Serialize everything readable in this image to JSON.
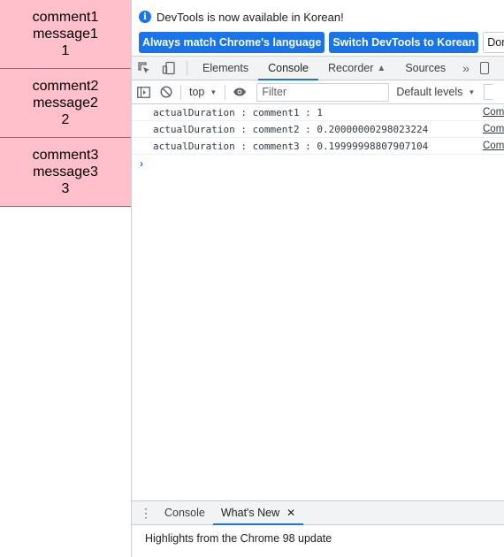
{
  "page": {
    "comments": [
      {
        "name": "comment1",
        "message": "message1",
        "count": "1"
      },
      {
        "name": "comment2",
        "message": "message2",
        "count": "2"
      },
      {
        "name": "comment3",
        "message": "message3",
        "count": "3"
      }
    ]
  },
  "infobar": {
    "text": "DevTools is now available in Korean!",
    "always_match_label": "Always match Chrome's language",
    "switch_label": "Switch DevTools to Korean",
    "dont_show_label": "Don't sh"
  },
  "tabs": {
    "items": [
      "Elements",
      "Console",
      "Recorder",
      "Sources"
    ],
    "active": "Console",
    "more": "»"
  },
  "console_toolbar": {
    "context": "top",
    "filter_placeholder": "Filter",
    "levels": "Default levels"
  },
  "console": {
    "messages": [
      {
        "text": "actualDuration : comment1 : 1",
        "source": "Comm"
      },
      {
        "text": "actualDuration : comment2 : 0.20000000298023224",
        "source": "Comm"
      },
      {
        "text": "actualDuration : comment3 : 0.19999998807907104",
        "source": "Comm"
      }
    ],
    "prompt": "›"
  },
  "drawer": {
    "tabs": [
      "Console",
      "What's New"
    ],
    "active": "What's New",
    "body": "Highlights from the Chrome 98 update"
  },
  "colors": {
    "comment_bg": "#ffc0cb",
    "accent": "#1a73e8"
  }
}
